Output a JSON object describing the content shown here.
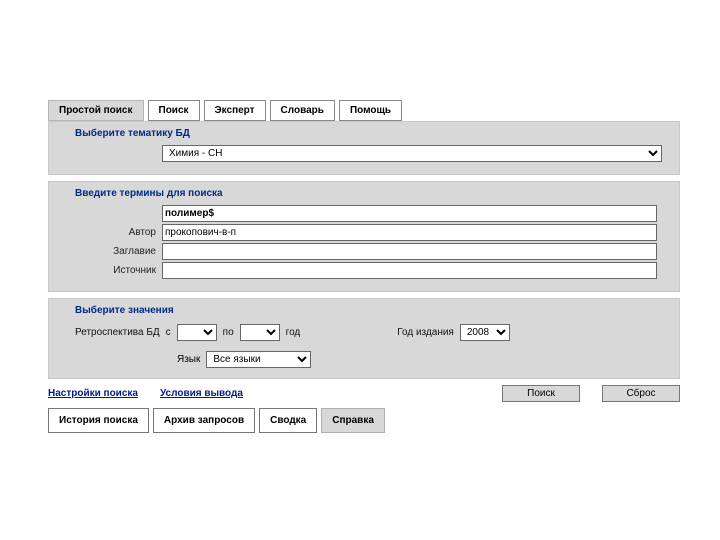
{
  "tabs_top": [
    {
      "label": "Простой поиск",
      "active": true
    },
    {
      "label": "Поиск"
    },
    {
      "label": "Эксперт"
    },
    {
      "label": "Словарь"
    },
    {
      "label": "Помощь"
    }
  ],
  "panel_subject": {
    "title": "Выберите тематику БД",
    "select_value": "Химия - CH"
  },
  "panel_terms": {
    "title": "Введите термины для поиска",
    "query": "полимер$",
    "author_label": "Автор",
    "author_value": "прокопович-в-п",
    "title_label": "Заглавие",
    "title_value": "",
    "source_label": "Источник",
    "source_value": ""
  },
  "panel_values": {
    "title": "Выберите значения",
    "retro_label": "Ретроспектива БД",
    "from": "с",
    "to": "по",
    "year_word": "год",
    "pub_year_label": "Год издания",
    "pub_year_value": "2008",
    "lang_label": "Язык",
    "lang_value": "Все языки"
  },
  "links": {
    "settings": "Настройки поиска",
    "output": "Условия вывода"
  },
  "buttons": {
    "search": "Поиск",
    "reset": "Сброс"
  },
  "tabs_bottom": [
    {
      "label": "История поиска"
    },
    {
      "label": "Архив запросов"
    },
    {
      "label": "Сводка"
    },
    {
      "label": "Справка",
      "grey": true
    }
  ]
}
